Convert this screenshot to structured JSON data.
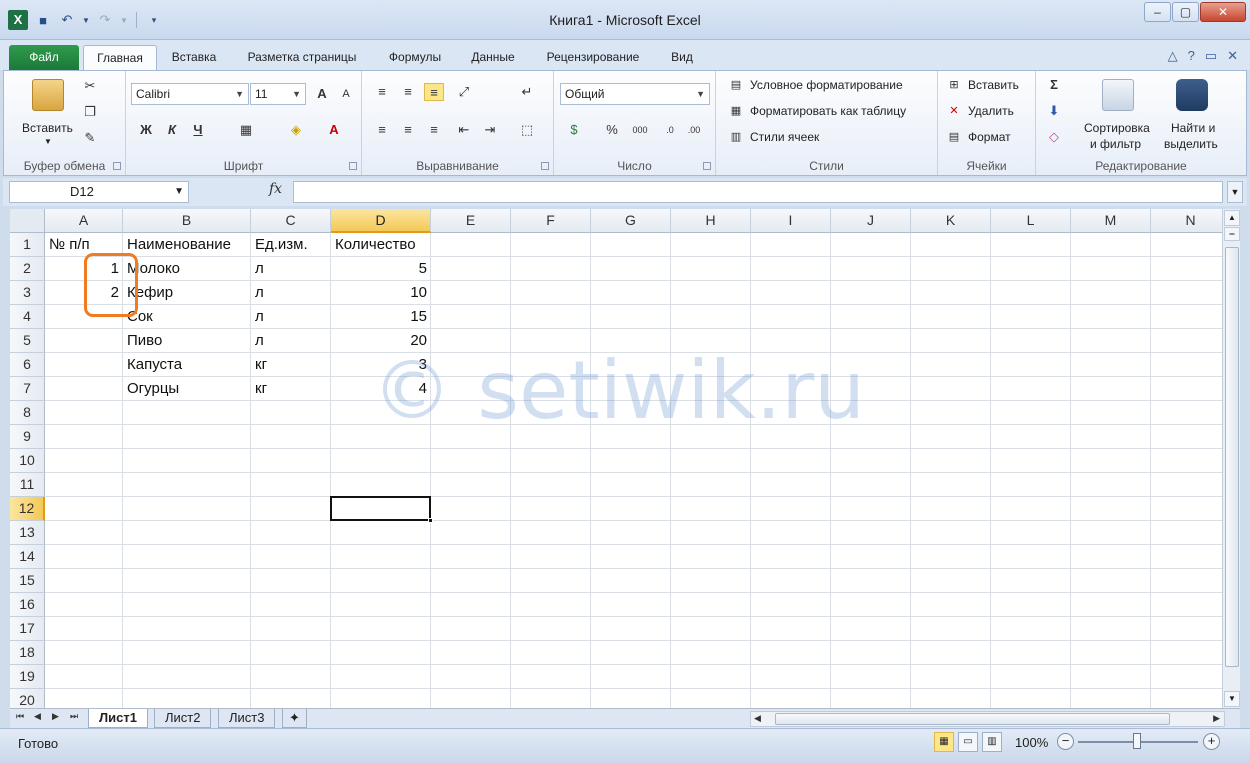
{
  "window": {
    "title": "Книга1 - Microsoft Excel"
  },
  "qat_icons": [
    "excel-logo-icon",
    "save-icon",
    "undo-icon",
    "redo-icon",
    "customize-icon"
  ],
  "tabs": {
    "file": "Файл",
    "items": [
      "Главная",
      "Вставка",
      "Разметка страницы",
      "Формулы",
      "Данные",
      "Рецензирование",
      "Вид"
    ],
    "active": "Главная"
  },
  "ribbon": {
    "clipboard": {
      "label": "Буфер обмена",
      "paste": "Вставить"
    },
    "font": {
      "label": "Шрифт",
      "name": "Calibri",
      "size": "11",
      "bold": "Ж",
      "italic": "К",
      "underline": "Ч"
    },
    "alignment": {
      "label": "Выравнивание"
    },
    "number": {
      "label": "Число",
      "format": "Общий",
      "percent": "%",
      "thousands": "000"
    },
    "styles": {
      "label": "Стили",
      "cond_format": "Условное форматирование",
      "format_table": "Форматировать как таблицу",
      "cell_styles": "Стили ячеек"
    },
    "cells": {
      "label": "Ячейки",
      "insert": "Вставить",
      "delete": "Удалить",
      "format": "Формат"
    },
    "editing": {
      "label": "Редактирование",
      "sort_filter_1": "Сортировка",
      "sort_filter_2": "и фильтр",
      "find_1": "Найти и",
      "find_2": "выделить"
    }
  },
  "formula_bar": {
    "name_box": "D12",
    "fx": "fx",
    "value": ""
  },
  "sheet": {
    "columns": [
      "A",
      "B",
      "C",
      "D",
      "E",
      "F",
      "G",
      "H",
      "I",
      "J",
      "K",
      "L",
      "M",
      "N"
    ],
    "rows": [
      "1",
      "2",
      "3",
      "4",
      "5",
      "6",
      "7",
      "8",
      "9",
      "10",
      "11",
      "12",
      "13",
      "14",
      "15",
      "16",
      "17",
      "18",
      "19",
      "20"
    ],
    "selected_cell": "D12",
    "header_row": [
      "№ п/п",
      "Наименование",
      "Ед.изм.",
      "Количество"
    ],
    "data": [
      {
        "num": "1",
        "name": "Молоко",
        "unit": "л",
        "qty": "5"
      },
      {
        "num": "2",
        "name": "Кефир",
        "unit": "л",
        "qty": "10"
      },
      {
        "num": "",
        "name": "Сок",
        "unit": "л",
        "qty": "15"
      },
      {
        "num": "",
        "name": "Пиво",
        "unit": "л",
        "qty": "20"
      },
      {
        "num": "",
        "name": "Капуста",
        "unit": "кг",
        "qty": "3"
      },
      {
        "num": "",
        "name": "Огурцы",
        "unit": "кг",
        "qty": "4"
      }
    ],
    "watermark": "© setiwik.ru"
  },
  "sheet_tabs": [
    "Лист1",
    "Лист2",
    "Лист3"
  ],
  "status": {
    "ready": "Готово",
    "zoom": "100%"
  },
  "colors": {
    "accent_green": "#1c7a38",
    "selection_orange": "#f07b21",
    "header_highlight": "#f3c957"
  }
}
